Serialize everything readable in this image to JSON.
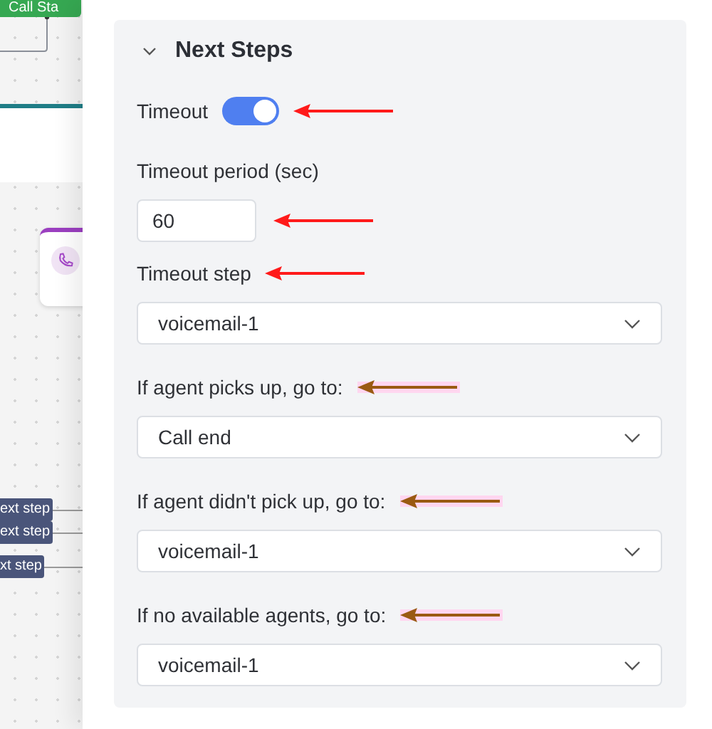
{
  "canvas": {
    "start_button": {
      "label": "Call Sta"
    },
    "step_tags": [
      {
        "label": "ext step"
      },
      {
        "label": "ext step"
      },
      {
        "label": "xt step"
      }
    ]
  },
  "panel": {
    "section": {
      "title": "Next Steps",
      "expanded": true
    },
    "fields": [
      {
        "kind": "toggle",
        "label": "Timeout",
        "on": true,
        "arrow": {
          "color": "#ff1a1a",
          "highlight": false
        }
      },
      {
        "kind": "number",
        "label": "Timeout period (sec)",
        "value": "60",
        "arrow": {
          "color": "#ff1a1a",
          "highlight": false
        }
      },
      {
        "kind": "select",
        "label": "Timeout step",
        "value": "voicemail-1",
        "arrow": {
          "color": "#ff1a1a",
          "highlight": false
        }
      },
      {
        "kind": "select",
        "label": "If agent picks up, go to:",
        "value": "Call end",
        "arrow": {
          "color": "#9a5a12",
          "highlight": true
        }
      },
      {
        "kind": "select",
        "label": "If agent didn't pick up, go to:",
        "value": "voicemail-1",
        "arrow": {
          "color": "#9a5a12",
          "highlight": true
        }
      },
      {
        "kind": "select",
        "label": "If no available agents, go to:",
        "value": "voicemail-1",
        "arrow": {
          "color": "#9a5a12",
          "highlight": true
        }
      }
    ]
  }
}
